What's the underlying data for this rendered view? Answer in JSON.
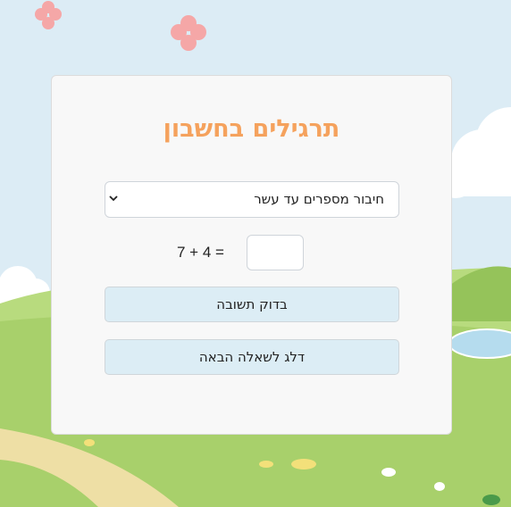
{
  "page": {
    "title": "תרגילים בחשבון"
  },
  "exercise_select": {
    "selected": "חיבור מספרים עד עשר"
  },
  "problem": {
    "equation": "7 + 4 =",
    "answer_value": ""
  },
  "buttons": {
    "check_label": "בדוק תשובה",
    "skip_label": "דלג לשאלה הבאה"
  },
  "colors": {
    "title": "#f5a25d",
    "button_bg": "#dcedf5",
    "sky": "#dcecf5",
    "grass": "#a8d06b"
  },
  "icons": {
    "select_arrow": "chevron-down-icon"
  }
}
